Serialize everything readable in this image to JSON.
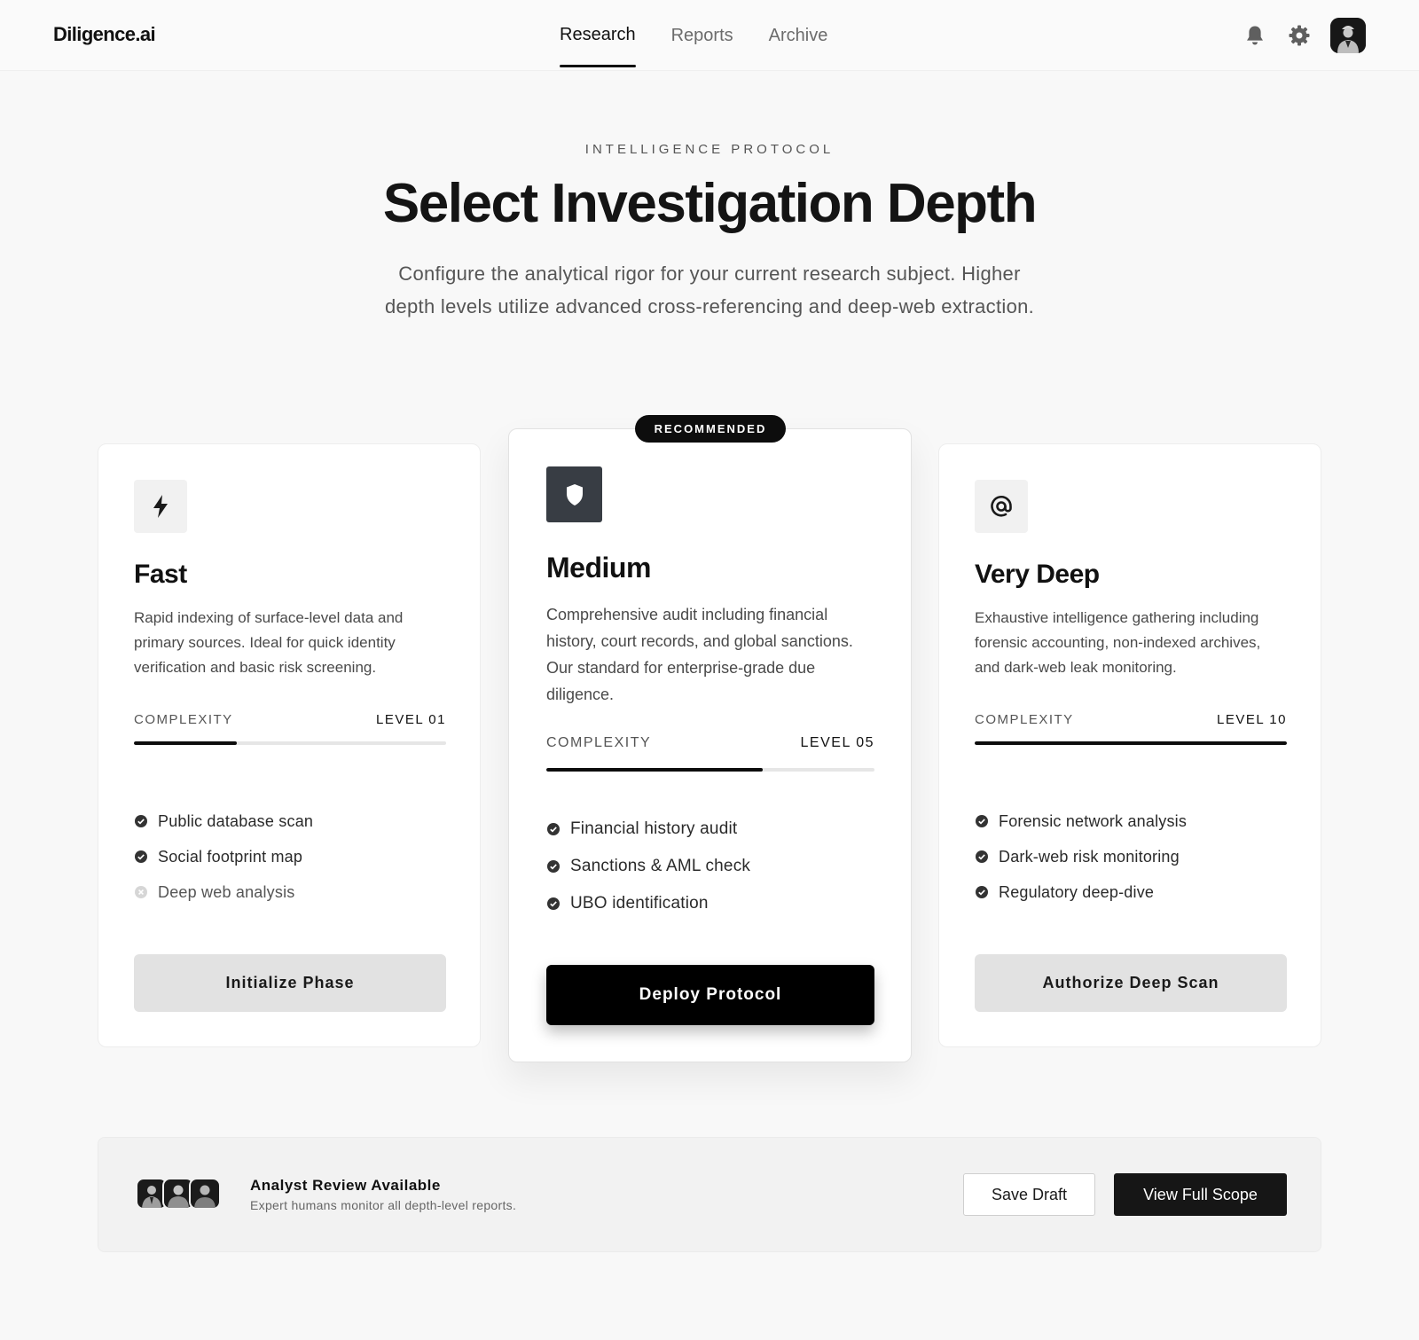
{
  "nav": {
    "brand": "Diligence.ai",
    "links": [
      {
        "label": "Research",
        "active": true
      },
      {
        "label": "Reports",
        "active": false
      },
      {
        "label": "Archive",
        "active": false
      }
    ],
    "icons": [
      "bell-icon",
      "gear-icon",
      "user-avatar"
    ]
  },
  "hero": {
    "eyebrow": "INTELLIGENCE PROTOCOL",
    "title": "Select Investigation Depth",
    "subtitle": "Configure the analytical rigor for your current research subject. Higher depth levels utilize advanced cross-referencing and deep-web extraction."
  },
  "cards": [
    {
      "icon": "bolt-icon",
      "title": "Fast",
      "description": "Rapid indexing of surface-level data and primary sources. Ideal for quick identity verification and basic risk screening.",
      "complexity_label": "COMPLEXITY",
      "level": "LEVEL 01",
      "complexity_fraction": 0.33,
      "features": [
        {
          "label": "Public database scan",
          "included": true
        },
        {
          "label": "Social footprint map",
          "included": true
        },
        {
          "label": "Deep web analysis",
          "included": false
        }
      ],
      "button": "Initialize Phase"
    },
    {
      "badge": "RECOMMENDED",
      "icon": "shield-icon",
      "title": "Medium",
      "description": "Comprehensive audit including financial history, court records, and global sanctions. Our standard for enterprise-grade due diligence.",
      "complexity_label": "COMPLEXITY",
      "level": "LEVEL 05",
      "complexity_fraction": 0.66,
      "features": [
        {
          "label": "Financial history audit",
          "included": true
        },
        {
          "label": "Sanctions & AML check",
          "included": true
        },
        {
          "label": "UBO identification",
          "included": true
        }
      ],
      "button": "Deploy Protocol"
    },
    {
      "icon": "at-sign-icon",
      "title": "Very Deep",
      "description": "Exhaustive intelligence gathering including forensic accounting, non-indexed archives, and dark-web leak monitoring.",
      "complexity_label": "COMPLEXITY",
      "level": "LEVEL 10",
      "complexity_fraction": 1.0,
      "features": [
        {
          "label": "Forensic network analysis",
          "included": true
        },
        {
          "label": "Dark-web risk monitoring",
          "included": true
        },
        {
          "label": "Regulatory deep-dive",
          "included": true
        }
      ],
      "button": "Authorize Deep Scan"
    }
  ],
  "analyst": {
    "title": "Analyst Review Available",
    "subtitle": "Expert humans monitor all depth-level reports.",
    "save_label": "Save Draft",
    "scope_label": "View Full Scope"
  },
  "colors": {
    "accent": "#0d0d0d",
    "background": "#f8f8f8",
    "card": "#ffffff",
    "track": "#e6e6e6",
    "featured_icon_bg": "#383d44"
  }
}
